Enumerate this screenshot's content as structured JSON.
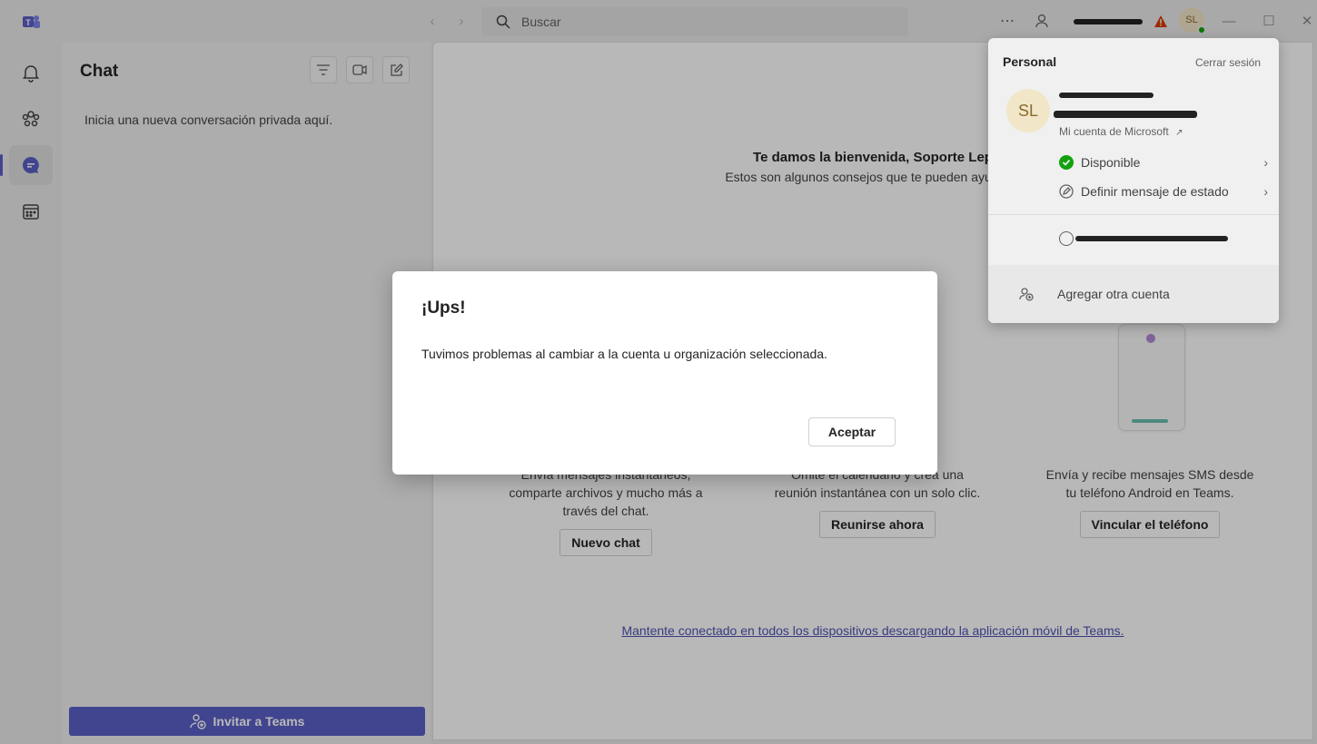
{
  "titlebar": {
    "search_placeholder": "Buscar",
    "user_initials": "SL"
  },
  "chat_panel": {
    "title": "Chat",
    "hint": "Inicia una nueva conversación privada aquí.",
    "invite_label": "Invitar a Teams"
  },
  "main": {
    "welcome_title": "Te damos la bienvenida, Soporte Lep",
    "welcome_subtitle": "Estos son algunos consejos que te pueden ayudar a",
    "cards": [
      {
        "text": "Envía mensajes instantáneos, comparte archivos y mucho más a través del chat.",
        "button": "Nuevo chat"
      },
      {
        "text": "Omite el calendario y crea una reunión instantánea con un solo clic.",
        "button": "Reunirse ahora"
      },
      {
        "text": "Envía y recibe mensajes SMS desde tu teléfono Android en Teams.",
        "button": "Vincular el teléfono"
      }
    ],
    "mobile_link": "Mantente conectado en todos los dispositivos descargando la aplicación móvil de Teams."
  },
  "account_flyout": {
    "heading": "Personal",
    "sign_out": "Cerrar sesión",
    "avatar_initials": "SL",
    "ms_account_link": "Mi cuenta de Microsoft",
    "status": "Disponible",
    "status_color": "#13a10e",
    "set_status_message": "Definir mensaje de estado",
    "add_account": "Agregar otra cuenta"
  },
  "dialog": {
    "title": "¡Ups!",
    "message": "Tuvimos problemas al cambiar a la cuenta u organización seleccionada.",
    "ok_label": "Aceptar"
  },
  "colors": {
    "brand": "#5b5fc7",
    "warning": "#d83b01"
  }
}
